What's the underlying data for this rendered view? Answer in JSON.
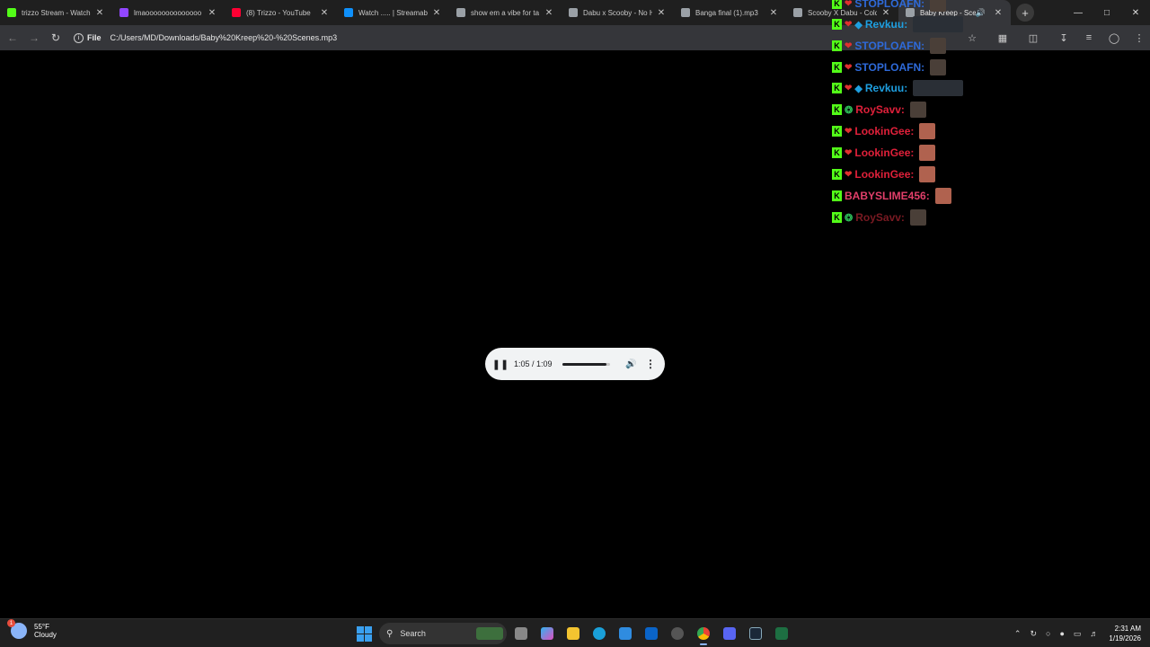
{
  "browser": {
    "tabs": [
      {
        "title": "trizzo Stream - Watch",
        "favicon": "kick-icon",
        "color": "#53fc18",
        "active": false
      },
      {
        "title": "lmaoooooooooooooo",
        "favicon": "twitch-icon",
        "color": "#9146ff",
        "active": false
      },
      {
        "title": "(8) Trizzo - YouTube",
        "favicon": "youtube-icon",
        "color": "#ff0033",
        "active": false
      },
      {
        "title": "Watch ..... | Streamable",
        "favicon": "streamable-icon",
        "color": "#0f90fa",
        "active": false
      },
      {
        "title": "show em a vibe for ta",
        "favicon": "globe-icon",
        "color": "#9aa0a6",
        "active": false
      },
      {
        "title": "Dabu x Scooby - No H",
        "favicon": "globe-icon",
        "color": "#9aa0a6",
        "active": false
      },
      {
        "title": "Banga final (1).mp3",
        "favicon": "globe-icon",
        "color": "#9aa0a6",
        "active": false
      },
      {
        "title": "Scooby X Dabu - Cold",
        "favicon": "globe-icon",
        "color": "#9aa0a6",
        "active": false
      },
      {
        "title": "Baby Kreep - Sce",
        "favicon": "globe-icon",
        "color": "#9aa0a6",
        "active": true
      }
    ],
    "new_tab_label": "+",
    "address": {
      "scheme_label": "File",
      "url": "C:/Users/MD/Downloads/Baby%20Kreep%20-%20Scenes.mp3"
    }
  },
  "player": {
    "time": "1:05 / 1:09",
    "progress": 0.94
  },
  "chat": {
    "messages": [
      {
        "user": "STOPLOAFN:",
        "color": "#2e6ad9",
        "badges": [
          "kick",
          "red"
        ],
        "emote": "dark"
      },
      {
        "user": "Revkuu:",
        "color": "#1e9fe0",
        "badges": [
          "kick",
          "red",
          "blue"
        ],
        "emote": "wide"
      },
      {
        "user": "STOPLOAFN:",
        "color": "#2e6ad9",
        "badges": [
          "kick",
          "red"
        ],
        "emote": "dark"
      },
      {
        "user": "STOPLOAFN:",
        "color": "#2e6ad9",
        "badges": [
          "kick",
          "red"
        ],
        "emote": "dark"
      },
      {
        "user": "Revkuu:",
        "color": "#1e9fe0",
        "badges": [
          "kick",
          "red",
          "blue"
        ],
        "emote": "wide"
      },
      {
        "user": "RoySavv:",
        "color": "#e0203a",
        "badges": [
          "kick",
          "green"
        ],
        "emote": "dark"
      },
      {
        "user": "LookinGee:",
        "color": "#e0203a",
        "badges": [
          "kick",
          "red"
        ],
        "emote": "face"
      },
      {
        "user": "LookinGee:",
        "color": "#e0203a",
        "badges": [
          "kick",
          "red"
        ],
        "emote": "face"
      },
      {
        "user": "LookinGee:",
        "color": "#e0203a",
        "badges": [
          "kick",
          "red"
        ],
        "emote": "face"
      },
      {
        "user": "BABYSLIME456:",
        "color": "#e23f6a",
        "badges": [
          "kick"
        ],
        "emote": "face"
      },
      {
        "user": "RoySavv:",
        "color": "#7a1a22",
        "badges": [
          "kick",
          "green"
        ],
        "emote": "dark"
      }
    ]
  },
  "taskbar": {
    "weather": {
      "temp": "55°F",
      "condition": "Cloudy",
      "badge": "1"
    },
    "search_label": "Search",
    "clock": {
      "time": "2:31 AM",
      "date": "1/19/2026"
    }
  }
}
